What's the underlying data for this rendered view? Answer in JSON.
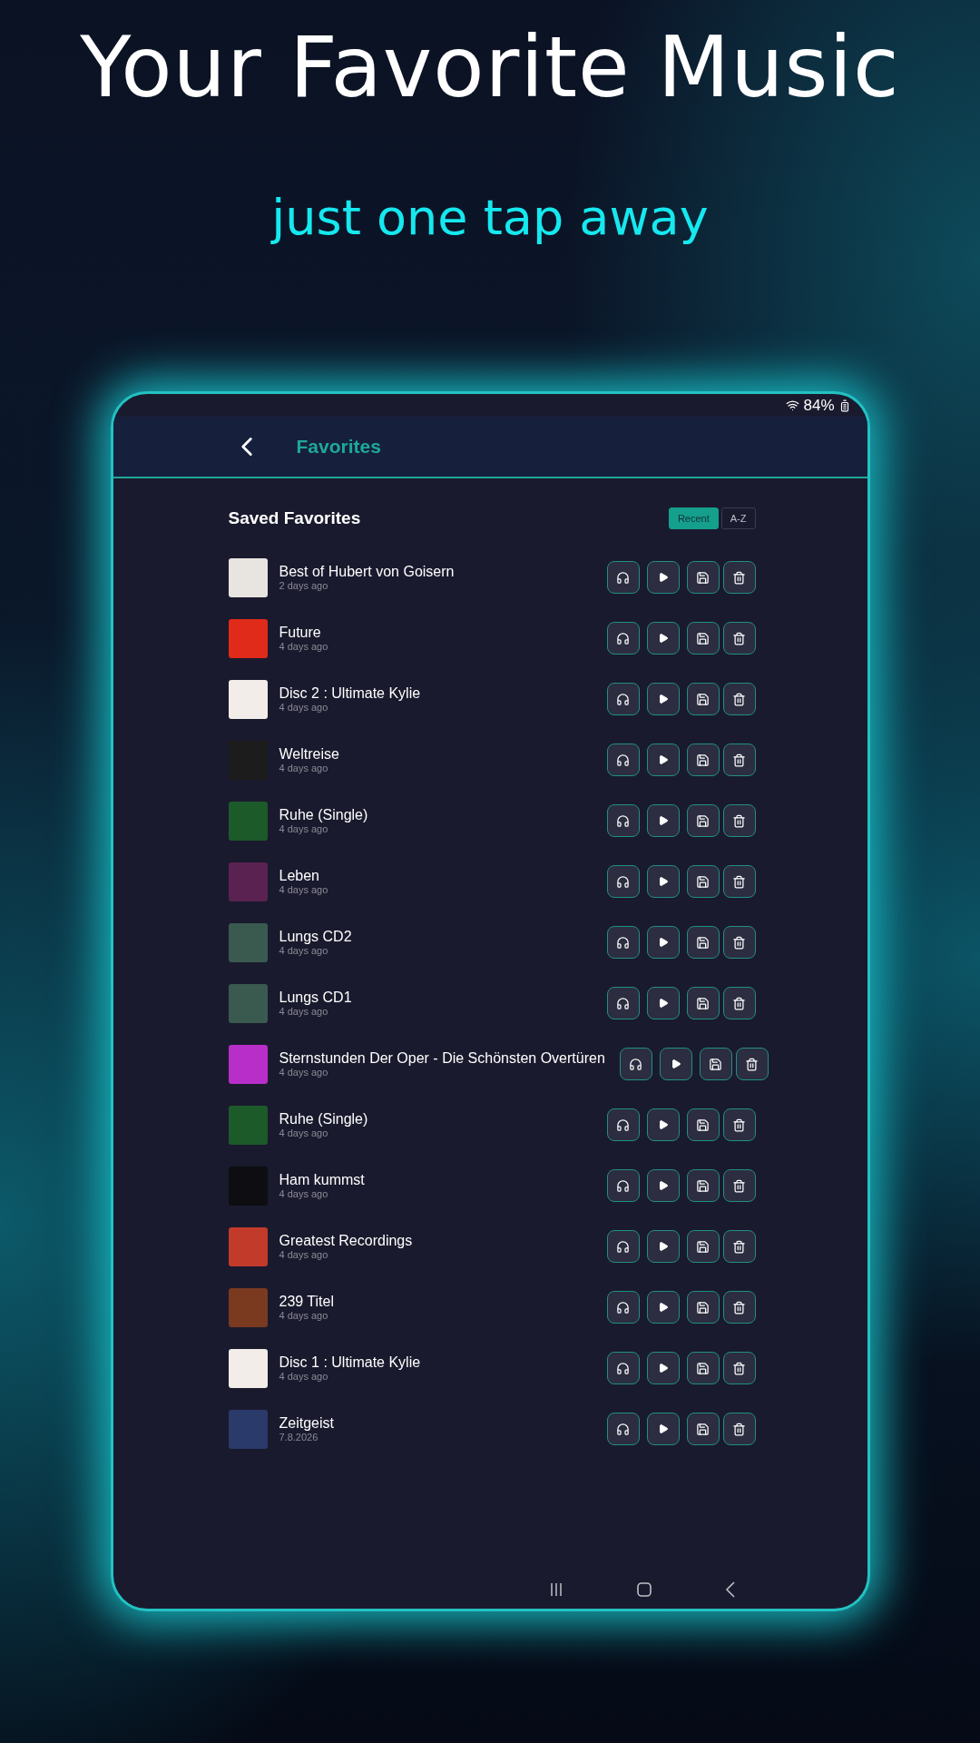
{
  "headline": "Your Favorite Music",
  "subheadline": "just one tap away",
  "status_bar": {
    "battery": "84%"
  },
  "header": {
    "title": "Favorites"
  },
  "section": {
    "title": "Saved Favorites"
  },
  "sort_tabs": [
    {
      "label": "Recent",
      "selected": true
    },
    {
      "label": "A-Z",
      "selected": false
    }
  ],
  "favorites": [
    {
      "title": "Best of Hubert von Goisern",
      "time": "2 days ago",
      "color": "#e8e4e0"
    },
    {
      "title": "Future",
      "time": "4 days ago",
      "color": "#e02a1a"
    },
    {
      "title": "Disc 2 : Ultimate Kylie",
      "time": "4 days ago",
      "color": "#f2ede8"
    },
    {
      "title": "Weltreise",
      "time": "4 days ago",
      "color": "#1c1c1c"
    },
    {
      "title": "Ruhe (Single)",
      "time": "4 days ago",
      "color": "#1d5a2a"
    },
    {
      "title": "Leben",
      "time": "4 days ago",
      "color": "#5a2250"
    },
    {
      "title": "Lungs CD2",
      "time": "4 days ago",
      "color": "#3a5a50"
    },
    {
      "title": "Lungs CD1",
      "time": "4 days ago",
      "color": "#3a5a50"
    },
    {
      "title": "Sternstunden Der Oper - Die Schönsten Overtüren",
      "time": "4 days ago",
      "color": "#b82ec8"
    },
    {
      "title": "Ruhe (Single)",
      "time": "4 days ago",
      "color": "#1d5a2a"
    },
    {
      "title": "Ham kummst",
      "time": "4 days ago",
      "color": "#0e0e12"
    },
    {
      "title": "Greatest Recordings",
      "time": "4 days ago",
      "color": "#c23a2a"
    },
    {
      "title": "239 Titel",
      "time": "4 days ago",
      "color": "#7a3a20"
    },
    {
      "title": "Disc 1 : Ultimate Kylie",
      "time": "4 days ago",
      "color": "#f2ede8"
    },
    {
      "title": "Zeitgeist",
      "time": "7.8.2026",
      "color": "#2a3a6a"
    }
  ]
}
